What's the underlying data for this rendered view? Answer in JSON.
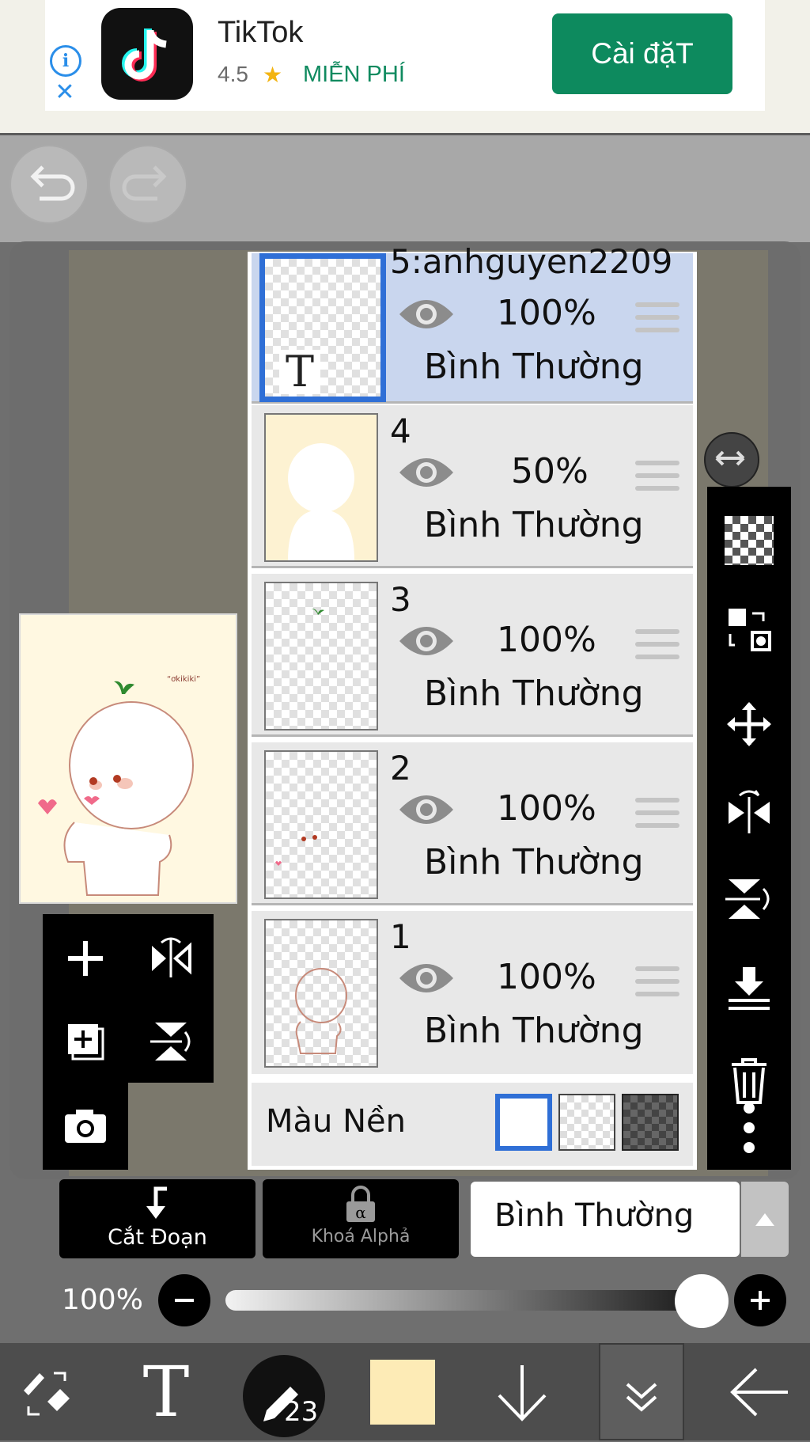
{
  "ad": {
    "app_name": "TikTok",
    "rating": "4.5",
    "star": "★",
    "price": "MIỄN PHÍ",
    "install_label": "Cài đặT",
    "info_icon": "info-icon",
    "close_icon": "close-icon"
  },
  "toolbar_top": {
    "undo_icon": "undo-icon",
    "redo_icon": "redo-icon"
  },
  "preview": {
    "watermark": "“ơkikiki”"
  },
  "layers": [
    {
      "name": "5:anhguyen2209",
      "opacity": "100%",
      "mode": "Bình Thường",
      "selected": true,
      "type_icon": "T"
    },
    {
      "name": "4",
      "opacity": "50%",
      "mode": "Bình Thường",
      "selected": false
    },
    {
      "name": "3",
      "opacity": "100%",
      "mode": "Bình Thường",
      "selected": false
    },
    {
      "name": "2",
      "opacity": "100%",
      "mode": "Bình Thường",
      "selected": false
    },
    {
      "name": "1",
      "opacity": "100%",
      "mode": "Bình Thường",
      "selected": false
    }
  ],
  "background": {
    "label": "Màu Nền",
    "selected": "white"
  },
  "bottom_controls": {
    "clip_label": "Cắt Đoạn",
    "alpha_lock_label": "Khoá Alphả",
    "blend_mode": "Bình Thường",
    "opacity_label": "100%",
    "opacity_value": 1.0
  },
  "bottom_bar": {
    "brush_size": "23",
    "color": "#fdebb6"
  },
  "colors": {
    "accent": "#2f6fd6",
    "install": "#0d8a5e",
    "selected_layer": "#c9d6ee"
  }
}
